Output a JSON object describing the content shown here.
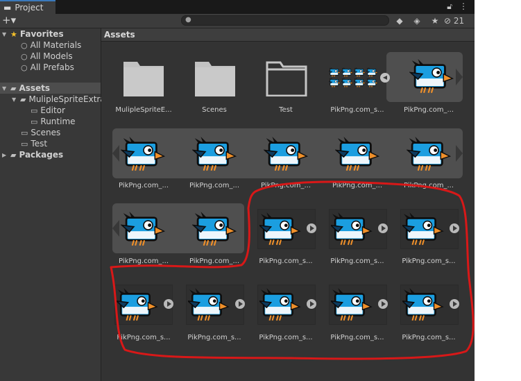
{
  "tab": {
    "title": "Project"
  },
  "toolbar": {
    "add_label": "+▾",
    "search_placeholder": "",
    "hidden_count": "21"
  },
  "sidebar": {
    "favorites": {
      "label": "Favorites",
      "items": [
        "All Materials",
        "All Models",
        "All Prefabs"
      ]
    },
    "assets": {
      "label": "Assets",
      "children": [
        {
          "label": "MulipleSpriteExtra"
        },
        {
          "label": "Editor"
        },
        {
          "label": "Runtime"
        },
        {
          "label": "Scenes"
        },
        {
          "label": "Test"
        }
      ]
    },
    "packages": {
      "label": "Packages"
    }
  },
  "main": {
    "header": "Assets",
    "row1": [
      "MulipleSpriteE...",
      "Scenes",
      "Test",
      "PikPng.com_s...",
      "PikPng.com_..."
    ],
    "row2": [
      "PikPng.com_...",
      "PikPng.com_...",
      "PikPng.com_...",
      "PikPng.com_...",
      "PikPng.com_..."
    ],
    "row3": [
      "PikPng.com_...",
      "PikPng.com_...",
      "PikPng.com_s...",
      "PikPng.com_s...",
      "PikPng.com_s..."
    ],
    "row4": [
      "PikPng.com_s...",
      "PikPng.com_s...",
      "PikPng.com_s...",
      "PikPng.com_s...",
      "PikPng.com_s..."
    ]
  },
  "colors": {
    "annotation": "#d81818",
    "bird_blue": "#1b9ee0",
    "beak": "#f0902a",
    "selection": "#4f4f4f"
  }
}
